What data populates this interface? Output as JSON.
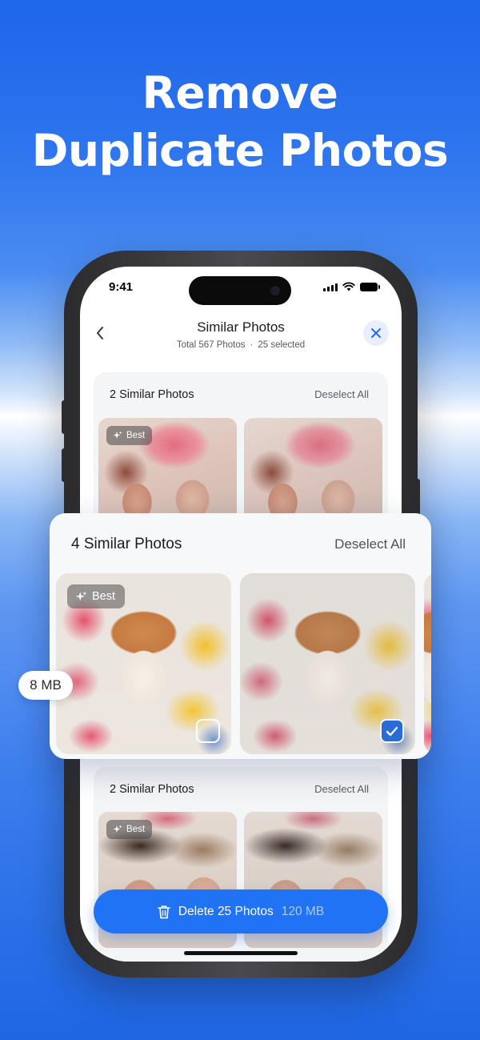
{
  "headline": {
    "line1": "Remove",
    "line2": "Duplicate Photos"
  },
  "status_bar": {
    "time": "9:41"
  },
  "nav": {
    "title": "Similar Photos",
    "total": "Total 567 Photos",
    "separator": "·",
    "selected": "25 selected"
  },
  "groups": [
    {
      "title": "2 Similar Photos",
      "action": "Deselect All",
      "badge": "Best"
    },
    {
      "title": "4 Similar Photos",
      "action": "Deselect All",
      "badge": "Best",
      "size": "8 MB",
      "items": [
        {
          "selected": false
        },
        {
          "selected": true
        }
      ]
    },
    {
      "title": "2 Similar Photos",
      "action": "Deselect All",
      "badge": "Best"
    }
  ],
  "delete_button": {
    "label": "Delete 25 Photos",
    "size": "120 MB"
  },
  "colors": {
    "accent": "#1f73f4",
    "background_top": "#1e66ea",
    "card": "#f4f5f7"
  }
}
